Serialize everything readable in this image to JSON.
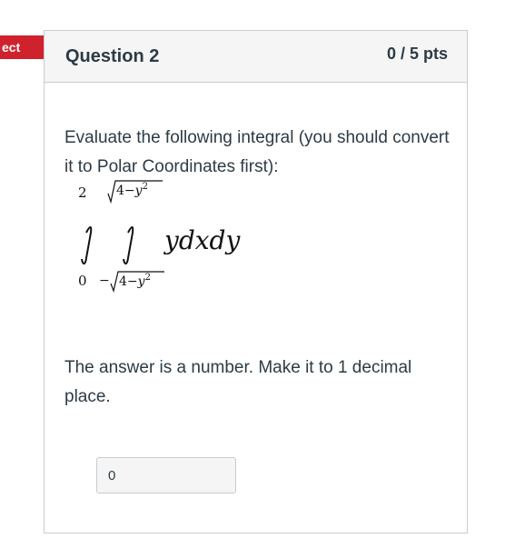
{
  "status_ribbon": {
    "label": "ect",
    "color": "#d0222d"
  },
  "question": {
    "title": "Question 2",
    "points": "0 / 5 pts",
    "prompt": "Evaluate the following integral (you should convert it to Polar Coordinates first):",
    "integral": {
      "outer_lower": "0",
      "outer_upper": "2",
      "inner_lower": "−√(4−y²)",
      "inner_upper": "√(4−y²)",
      "integrand": "ydxdy"
    },
    "instruction": "The answer is a number. Make it to 1 decimal place.",
    "answer_value": "0"
  }
}
